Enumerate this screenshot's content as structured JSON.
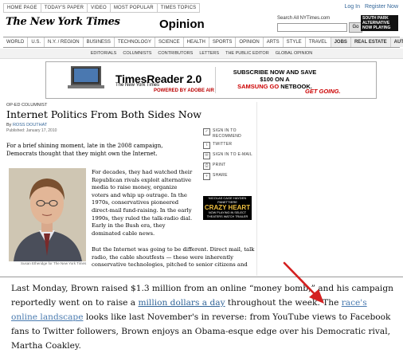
{
  "toplinks": [
    "HOME PAGE",
    "TODAY'S PAPER",
    "VIDEO",
    "MOST POPULAR",
    "TIMES TOPICS"
  ],
  "login": {
    "log_in": "Log In",
    "register": "Register Now"
  },
  "logo": "The New York Times",
  "section": "Opinion",
  "search": {
    "label": "Search All NYTimes.com",
    "button": "Go"
  },
  "small_ad": [
    "SOUTH PARK",
    "ALTERNATIVE",
    "NOW PLAYING"
  ],
  "nav_primary": [
    "WORLD",
    "U.S.",
    "N.Y. / REGION",
    "BUSINESS",
    "TECHNOLOGY",
    "SCIENCE",
    "HEALTH",
    "SPORTS",
    "OPINION",
    "ARTS",
    "STYLE",
    "TRAVEL",
    "JOBS",
    "REAL ESTATE",
    "AUTOS"
  ],
  "nav_secondary": [
    "EDITORIALS",
    "COLUMNISTS",
    "CONTRIBUTORS",
    "LETTERS",
    "THE PUBLIC EDITOR",
    "GLOBAL OPINION"
  ],
  "banner": {
    "product": "TimesReader 2.0",
    "sub": "The New York Times",
    "adobe": "POWERED BY ADOBE AIR",
    "offer_line1": "SUBSCRIBE NOW AND SAVE $100 ON A",
    "offer_brand": "SAMSUNG GO",
    "offer_tail": " NETBOOK.",
    "cta": "GET GOING."
  },
  "article": {
    "kicker": "OP-ED COLUMNIST",
    "headline": "Internet Politics From Both Sides Now",
    "by": "By ",
    "author": "ROSS DOUTHAT",
    "published": "Published: January 17, 2010",
    "lede": "For a brief shining moment, late in the 2008 campaign, Democrats thought that they might own the Internet.",
    "body_col": "For decades, they had watched their Republican rivals exploit alternative media to raise money, organize voters and whip up outrage. In the 1970s, conservatives pioneered direct-mail fund-raising. In the early 1990s, they ruled the talk-radio dial. Early in the Bush era, they dominated cable news.",
    "body_wide": "But the Internet was going to be different. Direct mail, talk radio, the cable shoutfests — these were inherently conservative technologies, pitched to senior citizens and",
    "photo_caption": "Susan Etheridge for The New York Times"
  },
  "tools": [
    {
      "icon": "recommend-icon",
      "label": "SIGN IN TO RECOMMEND"
    },
    {
      "icon": "twitter-icon",
      "label": "TWITTER"
    },
    {
      "icon": "email-icon",
      "label": "SIGN IN TO E-MAIL"
    },
    {
      "icon": "print-icon",
      "label": "PRINT"
    },
    {
      "icon": "share-icon",
      "label": "SHARE"
    }
  ],
  "movie_ad": {
    "top": "NICOLAS CAGE  HAYDEN PANETTIERE",
    "title": "CRAZY HEART",
    "bottom": "NOW PLAYING IN SELECT THEATERS  WATCH TRAILER"
  },
  "zoom": {
    "t1": "Last Monday, Brown raised $1.3 million from an online “money bomb,” and his campaign reportedly went on to raise a ",
    "link1": "million dollars a day",
    "t2": " throughout the week. The ",
    "link2": "race's online landscape",
    "t3": " looks like last November's in reverse: from YouTube views to Facebook fans to Twitter followers, Brown enjoys an Obama-esque edge over his Democratic rival, Martha Coakley."
  },
  "colors": {
    "link": "#336699",
    "accent": "#cc0000"
  }
}
